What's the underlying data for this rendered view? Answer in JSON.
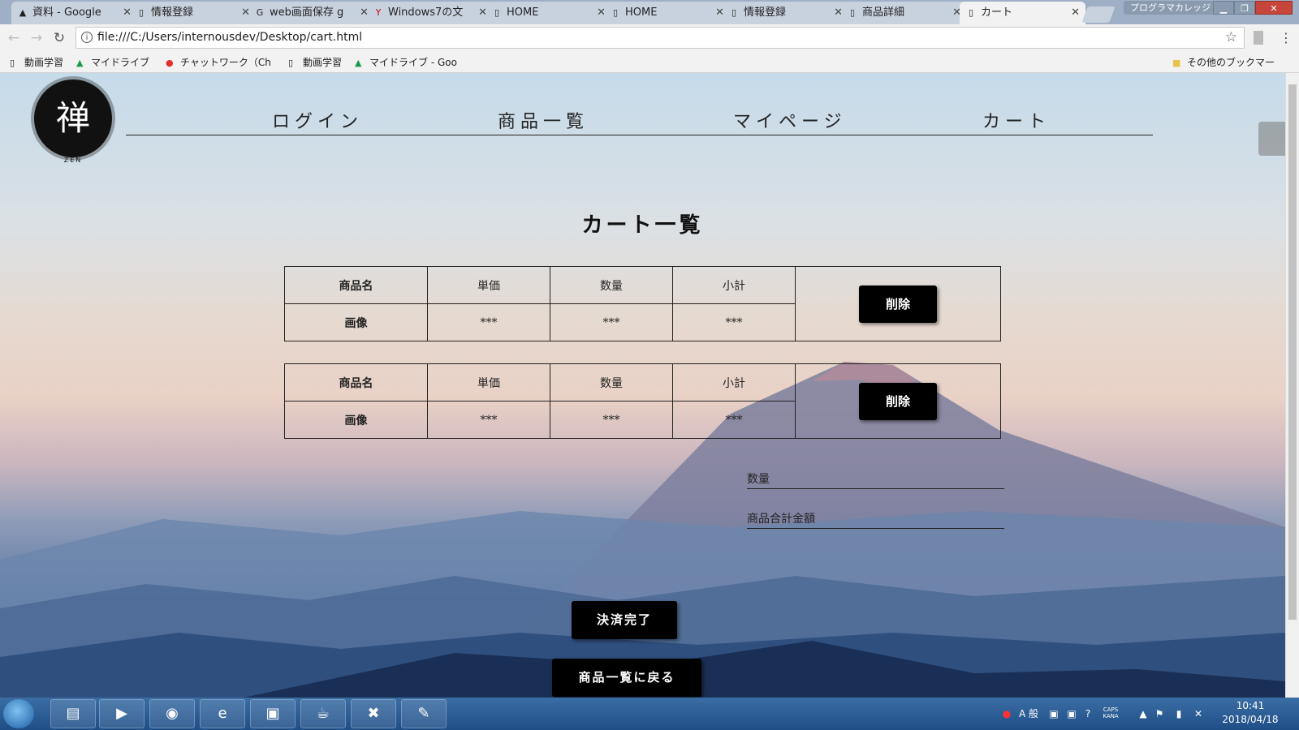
{
  "browser": {
    "tabs": [
      {
        "label": "資料 - Google",
        "icon": "drive-icon",
        "active": false
      },
      {
        "label": "情報登録",
        "icon": "page-icon",
        "active": false
      },
      {
        "label": "web画面保存 g",
        "icon": "google-icon",
        "active": false
      },
      {
        "label": "Windows7の文",
        "icon": "yahoo-icon",
        "active": false
      },
      {
        "label": "HOME",
        "icon": "page-icon",
        "active": false
      },
      {
        "label": "HOME",
        "icon": "page-icon",
        "active": false
      },
      {
        "label": "情報登録",
        "icon": "page-icon",
        "active": false
      },
      {
        "label": "商品詳細",
        "icon": "page-icon",
        "active": false
      },
      {
        "label": "カート",
        "icon": "page-icon",
        "active": true
      }
    ],
    "profile_label": "プログラマカレッジ",
    "url": "file:///C:/Users/internousdev/Desktop/cart.html",
    "bookmarks": [
      {
        "label": "動画学習",
        "icon": "page-icon"
      },
      {
        "label": "マイドライブ",
        "icon": "drive-icon"
      },
      {
        "label": "チャットワーク（Ch",
        "icon": "chatwork-icon"
      },
      {
        "label": "動画学習",
        "icon": "page-icon"
      },
      {
        "label": "マイドライブ - Goo",
        "icon": "drive-icon"
      },
      {
        "label": "その他のブックマー",
        "icon": "folder-icon"
      }
    ]
  },
  "site": {
    "logo_glyph": "禅",
    "logo_sub": "ZEN",
    "nav": [
      "ログイン",
      "商品一覧",
      "マイページ",
      "カート"
    ]
  },
  "cart": {
    "title": "カート一覧",
    "items": [
      {
        "name_label": "商品名",
        "image_label": "画像",
        "price_label": "単価",
        "qty_label": "数量",
        "subtotal_label": "小計",
        "price": "***",
        "qty": "***",
        "subtotal": "***",
        "delete_label": "削除"
      },
      {
        "name_label": "商品名",
        "image_label": "画像",
        "price_label": "単価",
        "qty_label": "数量",
        "subtotal_label": "小計",
        "price": "***",
        "qty": "***",
        "subtotal": "***",
        "delete_label": "削除"
      }
    ],
    "total_qty_label": "数量",
    "total_price_label": "商品合計金額",
    "checkout_label": "決済完了",
    "back_label": "商品一覧に戻る"
  },
  "taskbar": {
    "time": "10:41",
    "date": "2018/04/18",
    "ime_label": "A 般",
    "caps_label": "CAPS",
    "kana_label": "KANA"
  }
}
